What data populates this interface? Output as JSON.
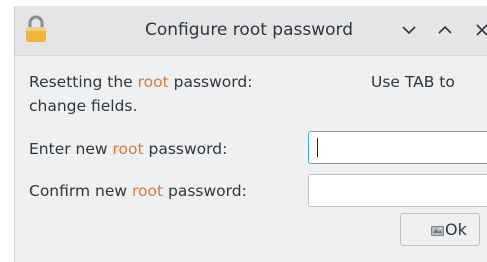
{
  "window": {
    "title": "Configure root password"
  },
  "intro": {
    "prefix": "Resetting the ",
    "keyword": "root",
    "suffix": " password:",
    "tab_hint": "Use TAB to",
    "line2": "change fields."
  },
  "new_password": {
    "prefix": "Enter new ",
    "keyword": "root",
    "suffix": " password:",
    "value": ""
  },
  "confirm_password": {
    "prefix": "Confirm new ",
    "keyword": "root",
    "suffix": " password:",
    "value": ""
  },
  "ok_button": {
    "label": "Ok"
  },
  "icons": {
    "app": "lock-icon",
    "minimize": "chevron-down-icon",
    "maximize": "chevron-up-icon",
    "close": "close-icon",
    "ok": "ok-icon"
  },
  "colors": {
    "keyword": "#dc7a35",
    "focus_border": "#3daee9"
  }
}
